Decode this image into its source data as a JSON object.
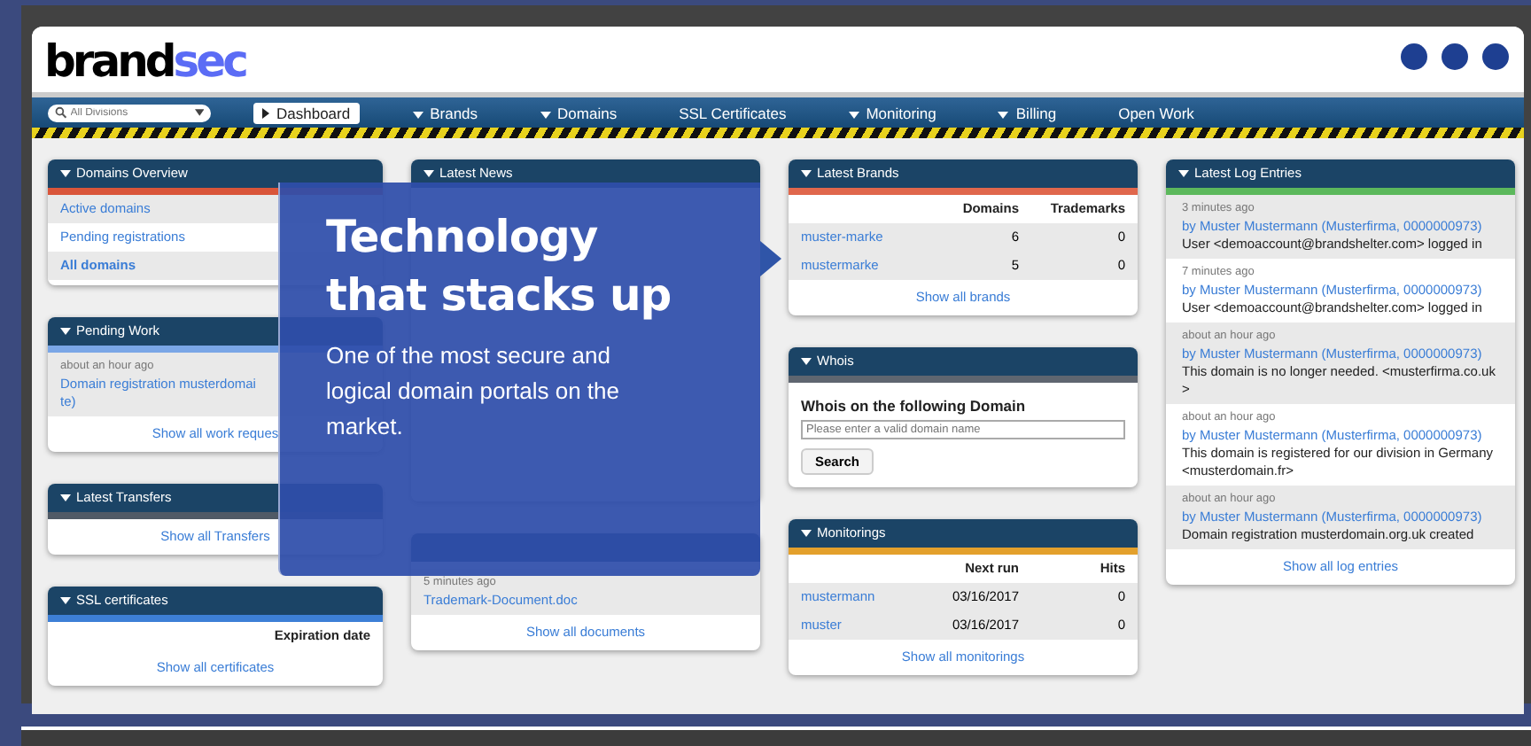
{
  "logo": {
    "part_1": "brand",
    "part_2": "sec"
  },
  "nav": {
    "search": {
      "placeholder": "All Divisions"
    },
    "items": [
      {
        "label": "Dashboard",
        "selected": true,
        "menu": true
      },
      {
        "label": "Brands",
        "selected": false,
        "menu": true
      },
      {
        "label": "Domains",
        "selected": false,
        "menu": true
      },
      {
        "label": "SSL Certificates",
        "selected": false,
        "menu": false
      },
      {
        "label": "Monitoring",
        "selected": false,
        "menu": true
      },
      {
        "label": "Billing",
        "selected": false,
        "menu": true
      },
      {
        "label": "Open Work",
        "selected": false,
        "menu": false
      }
    ]
  },
  "columns": [
    {
      "panels": [
        {
          "kind": "list",
          "title": "Domains Overview",
          "color": "#d9553a",
          "rows": [
            {
              "label": "Active domains",
              "emphasis": false
            },
            {
              "label": "Pending registrations",
              "emphasis": false
            },
            {
              "label": "All domains",
              "emphasis": true
            }
          ]
        },
        {
          "kind": "feed",
          "title": "Pending Work",
          "color": "#7aa6e6",
          "items": [
            {
              "time": "about an hour ago",
              "lines": [
                "Domain registration musterdomai",
                "te)"
              ]
            }
          ],
          "footer": "Show all work reques"
        },
        {
          "kind": "list",
          "title": "Latest Transfers",
          "color": "#505a66",
          "footer": "Show all Transfers"
        },
        {
          "kind": "table",
          "title": "SSL certificates",
          "color": "#3d7fd6",
          "headers": [
            "Expiration date"
          ],
          "footer": "Show all certificates"
        }
      ]
    },
    {
      "panels": [
        {
          "kind": "covered",
          "title": "Latest News"
        },
        {
          "kind": "feed",
          "items": [
            {
              "time": "5 minutes ago",
              "lines": [
                "Trademark-Document.doc"
              ]
            }
          ],
          "footer": "Show all documents"
        }
      ]
    },
    {
      "panels": [
        {
          "kind": "table",
          "title": "Latest Brands",
          "color": "#e0674c",
          "headers": [
            "Domains",
            "Trademarks"
          ],
          "rows": [
            {
              "name": "muster-marke",
              "values": [
                "6",
                "0"
              ]
            },
            {
              "name": "mustermarke",
              "values": [
                "5",
                "0"
              ]
            }
          ],
          "footer": "Show all brands"
        },
        {
          "kind": "whois",
          "title": "Whois",
          "color": "#5f6670",
          "heading": "Whois on the following Domain",
          "placeholder": "Please enter a valid domain name",
          "button": "Search"
        },
        {
          "kind": "table",
          "title": "Monitorings",
          "color": "#e3a02c",
          "headers": [
            "Next run",
            "Hits"
          ],
          "rows": [
            {
              "name": "mustermann",
              "values": [
                "03/16/2017",
                "0"
              ]
            },
            {
              "name": "muster",
              "values": [
                "03/16/2017",
                "0"
              ]
            }
          ],
          "footer": "Show all monitorings"
        }
      ]
    },
    {
      "panels": [
        {
          "kind": "log",
          "title": "Latest Log Entries",
          "color": "#5cb85c",
          "entries": [
            {
              "time": "3 minutes ago",
              "author": "by Muster Mustermann (Musterfirma, 0000000973)",
              "message": "User <demoaccount@brandshelter.com> logged in"
            },
            {
              "time": "7 minutes ago",
              "author": "by Muster Mustermann (Musterfirma, 0000000973)",
              "message": "User <demoaccount@brandshelter.com> logged in"
            },
            {
              "time": "about an hour ago",
              "author": "by Muster Mustermann (Musterfirma, 0000000973)",
              "message": "This domain is no longer needed. <musterfirma.co.uk>"
            },
            {
              "time": "about an hour ago",
              "author": "by Muster Mustermann (Musterfirma, 0000000973)",
              "message": "This domain is registered for our division in Germany <musterdomain.fr>"
            },
            {
              "time": "about an hour ago",
              "author": "by Muster Mustermann (Musterfirma, 0000000973)",
              "message": "Domain registration musterdomain.org.uk created"
            }
          ],
          "footer": "Show all log entries"
        }
      ]
    }
  ],
  "promo": {
    "title": "Technology that stacks up",
    "text": "One of the most secure and logical domain portals on the market."
  }
}
